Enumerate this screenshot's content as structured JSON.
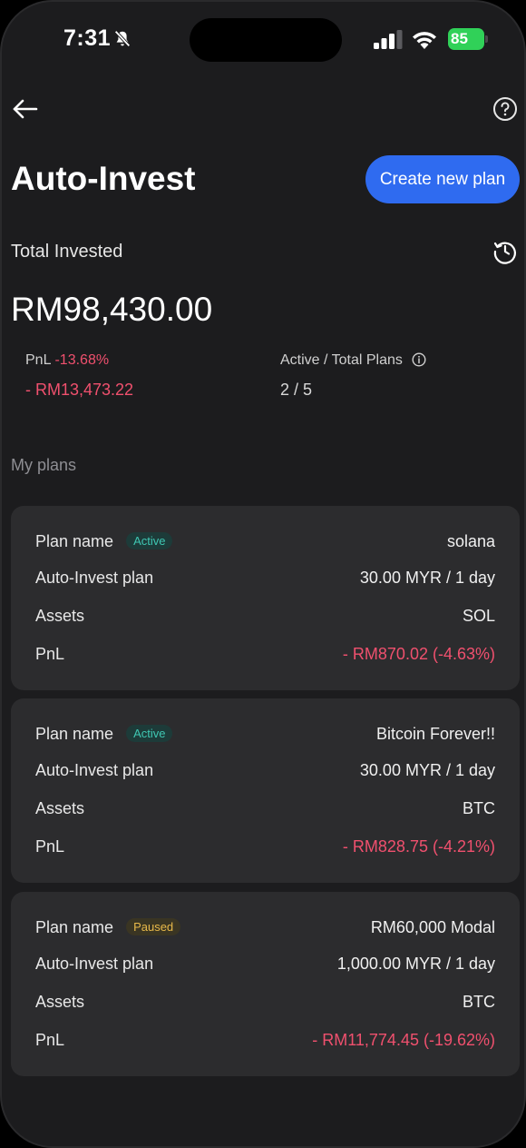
{
  "status_bar": {
    "time": "7:31",
    "battery": "85"
  },
  "header": {
    "title": "Auto-Invest",
    "create_label": "Create new plan"
  },
  "summary": {
    "total_label": "Total Invested",
    "total_value": "RM98,430.00",
    "pnl_label": "PnL",
    "pnl_pct": "-13.68%",
    "pnl_value": "- RM13,473.22",
    "plans_label": "Active / Total Plans",
    "plans_value": "2 / 5"
  },
  "section_label": "My plans",
  "labels": {
    "plan_name": "Plan name",
    "auto_invest_plan": "Auto-Invest plan",
    "assets": "Assets",
    "pnl": "PnL"
  },
  "plans": [
    {
      "status": "Active",
      "name": "solana",
      "schedule": "30.00 MYR / 1 day",
      "asset": "SOL",
      "pnl": "- RM870.02 (-4.63%)"
    },
    {
      "status": "Active",
      "name": "Bitcoin Forever!!",
      "schedule": "30.00 MYR / 1 day",
      "asset": "BTC",
      "pnl": "- RM828.75 (-4.21%)"
    },
    {
      "status": "Paused",
      "name": "RM60,000 Modal",
      "schedule": "1,000.00 MYR / 1 day",
      "asset": "BTC",
      "pnl": "- RM11,774.45 (-19.62%)"
    }
  ],
  "icons": [
    "bell-slash-icon",
    "signal-icon",
    "wifi-icon",
    "battery-icon",
    "back-arrow-icon",
    "help-icon",
    "history-icon",
    "info-icon"
  ],
  "colors": {
    "accent": "#2f6bf0",
    "negative": "#f0506e",
    "active_badge": "#3fc7b3",
    "paused_badge": "#e8b94a"
  }
}
